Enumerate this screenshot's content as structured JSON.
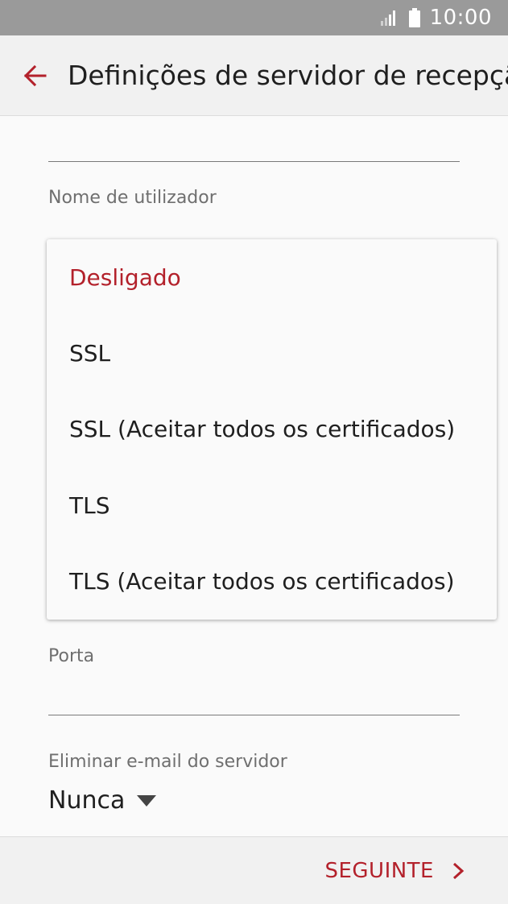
{
  "status_bar": {
    "time": "10:00",
    "signal_icon": "signal-icon",
    "battery_icon": "battery-icon"
  },
  "app_bar": {
    "back_icon": "arrow-left-icon",
    "title": "Definições de servidor de recepção"
  },
  "form": {
    "username_label": "Nome de utilizador",
    "port_label": "Porta",
    "delete_label": "Eliminar e-mail do servidor",
    "delete_value": "Nunca",
    "delete_caret_icon": "caret-down-icon"
  },
  "security_menu": {
    "options": [
      {
        "label": "Desligado",
        "selected": true
      },
      {
        "label": "SSL",
        "selected": false
      },
      {
        "label": "SSL (Aceitar todos os certificados)",
        "selected": false
      },
      {
        "label": "TLS",
        "selected": false
      },
      {
        "label": "TLS (Aceitar todos os certificados)",
        "selected": false
      }
    ]
  },
  "bottom_bar": {
    "next_label": "SEGUINTE",
    "next_icon": "chevron-right-icon"
  },
  "colors": {
    "accent": "#b3212b",
    "status_bar": "#9a9a9a",
    "app_bar": "#f1f1f1",
    "background": "#fafafa"
  }
}
